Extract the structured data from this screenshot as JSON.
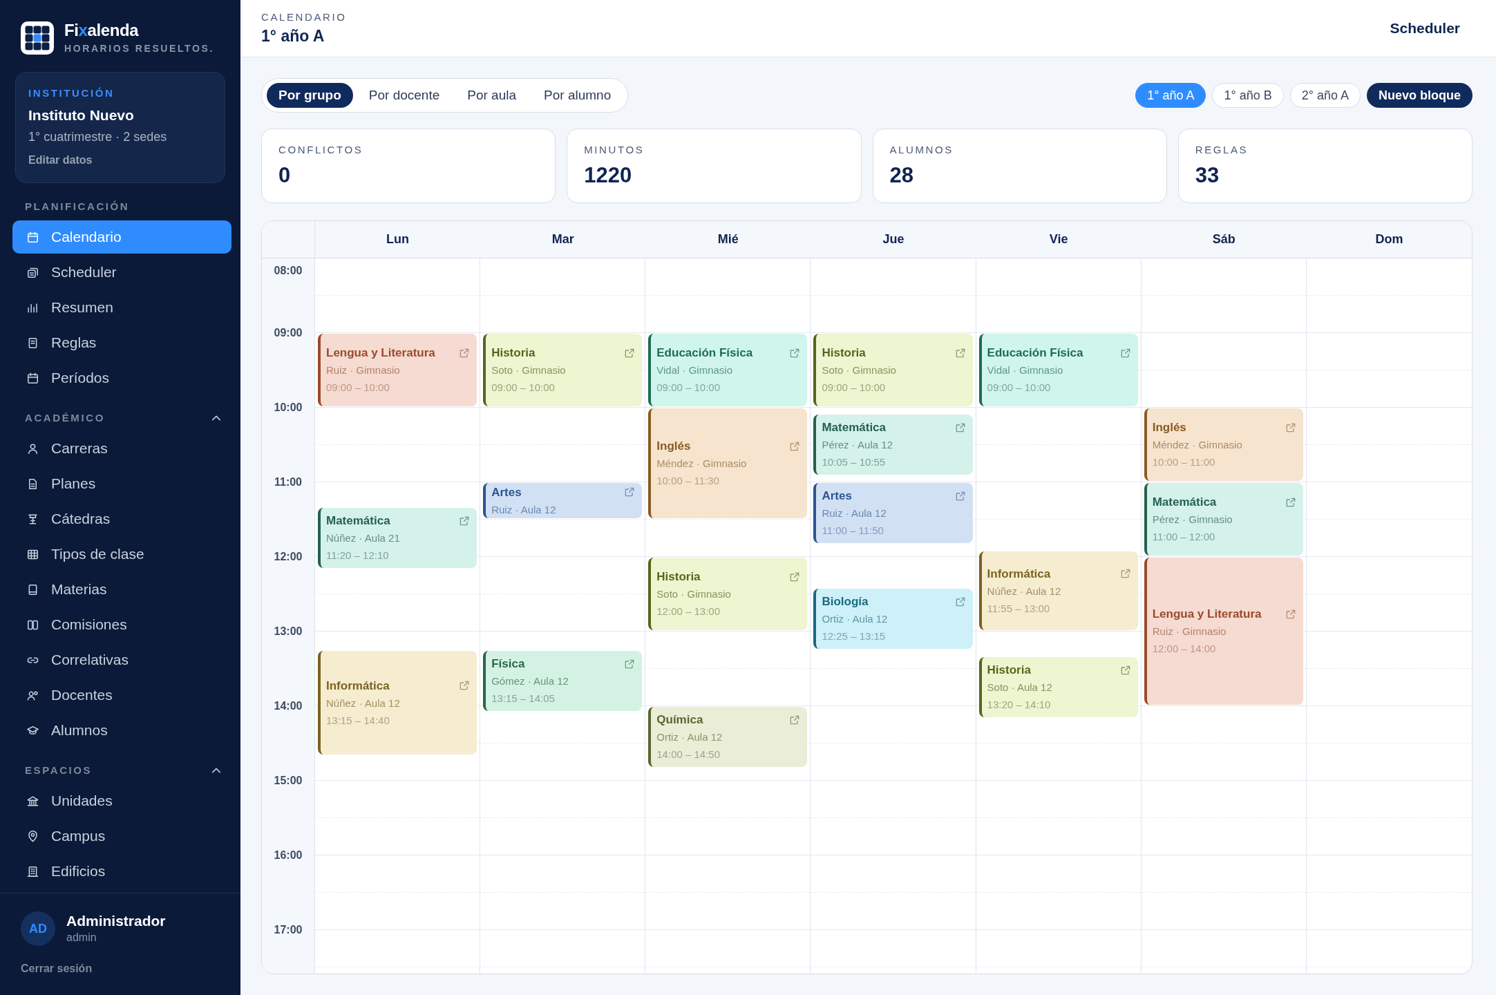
{
  "sidebar": {
    "brand": {
      "name_parts": [
        {
          "text": "Fi",
          "accent": false
        },
        {
          "text": "x",
          "accent": true
        },
        {
          "text": "alenda",
          "accent": false
        }
      ],
      "tagline": "HORARIOS RESUELTOS."
    },
    "institution": {
      "label": "INSTITUCIÓN",
      "name": "Instituto Nuevo",
      "meta": "1° cuatrimestre · 2 sedes",
      "link": "Editar datos"
    },
    "sections": [
      {
        "title": "PLANIFICACIÓN",
        "items": [
          {
            "label": "Calendario",
            "selected": true
          },
          {
            "label": "Scheduler",
            "selected": false
          },
          {
            "label": "Resumen",
            "selected": false
          },
          {
            "label": "Reglas",
            "selected": false
          },
          {
            "label": "Períodos",
            "selected": false
          }
        ]
      },
      {
        "title": "ACADÉMICO",
        "expanded": true,
        "items": [
          {
            "label": "Carreras",
            "selected": false
          },
          {
            "label": "Planes",
            "selected": false
          },
          {
            "label": "Cátedras",
            "selected": false
          },
          {
            "label": "Tipos de clase",
            "selected": false
          },
          {
            "label": "Materias",
            "selected": false
          },
          {
            "label": "Comisiones",
            "selected": false
          },
          {
            "label": "Correlativas",
            "selected": false
          },
          {
            "label": "Docentes",
            "selected": false
          },
          {
            "label": "Alumnos",
            "selected": false
          }
        ]
      },
      {
        "title": "ESPACIOS",
        "expanded": true,
        "items": [
          {
            "label": "Unidades",
            "selected": false
          },
          {
            "label": "Campus",
            "selected": false
          },
          {
            "label": "Edificios",
            "selected": false
          }
        ]
      }
    ],
    "user": {
      "initials": "AD",
      "name": "Administrador",
      "role": "admin",
      "logout": "Cerrar sesión"
    }
  },
  "header": {
    "eyebrow": "CALENDARIO",
    "title": "1° año A",
    "action": "Scheduler"
  },
  "view_tabs": [
    {
      "label": "Por grupo",
      "selected": true
    },
    {
      "label": "Por docente",
      "selected": false
    },
    {
      "label": "Por aula",
      "selected": false
    },
    {
      "label": "Por alumno",
      "selected": false
    }
  ],
  "groups": [
    {
      "label": "1° año A",
      "selected": true
    },
    {
      "label": "1° año B",
      "selected": false
    },
    {
      "label": "2° año A",
      "selected": false
    }
  ],
  "new_button": "Nuevo bloque",
  "stats": [
    {
      "label": "CONFLICTOS",
      "value": "0"
    },
    {
      "label": "MINUTOS",
      "value": "1220"
    },
    {
      "label": "ALUMNOS",
      "value": "28"
    },
    {
      "label": "REGLAS",
      "value": "33"
    }
  ],
  "calendar": {
    "hours": [
      "08:00",
      "09:00",
      "10:00",
      "11:00",
      "12:00",
      "13:00",
      "14:00",
      "15:00",
      "16:00",
      "17:00"
    ],
    "days": [
      {
        "label": "Lun",
        "events": [
          {
            "title": "Lengua y Literatura",
            "detail": "Ruiz · Gimnasio",
            "time": "09:00 – 10:00",
            "color": "#9a4a2c"
          },
          {
            "title": "Matemática",
            "detail": "Núñez · Aula 21",
            "time": "11:20 – 12:10",
            "color": "#24614f"
          },
          {
            "title": "Informática",
            "detail": "Núñez · Aula 12",
            "time": "13:15 – 14:40",
            "color": "#7a6320"
          }
        ]
      },
      {
        "label": "Mar",
        "events": [
          {
            "title": "Historia",
            "detail": "Soto · Gimnasio",
            "time": "09:00 – 10:00",
            "color": "#56661c"
          },
          {
            "title": "Artes",
            "detail": "Ruiz · Aula 12",
            "color": "#2c5592"
          },
          {
            "title": "Física",
            "detail": "Gómez · Aula 12",
            "time": "13:15 – 14:05",
            "color": "#276847"
          }
        ]
      },
      {
        "label": "Mié",
        "events": [
          {
            "title": "Educación Física",
            "detail": "Vidal · Gimnasio",
            "time": "09:00 – 10:00",
            "color": "#1d6b57"
          },
          {
            "title": "Inglés",
            "detail": "Méndez · Gimnasio",
            "time": "10:00 – 11:30",
            "color": "#8a5a22"
          },
          {
            "title": "Historia",
            "detail": "Soto · Gimnasio",
            "time": "12:00 – 13:00",
            "color": "#56661c"
          },
          {
            "title": "Química",
            "detail": "Ortiz · Aula 12",
            "time": "14:00 – 14:50",
            "color": "#5a6530"
          }
        ]
      },
      {
        "label": "Jue",
        "events": [
          {
            "title": "Historia",
            "detail": "Soto · Gimnasio",
            "time": "09:00 – 10:00",
            "color": "#56661c"
          },
          {
            "title": "Matemática",
            "detail": "Pérez · Aula 12",
            "time": "10:05 – 10:55",
            "color": "#24614f"
          },
          {
            "title": "Artes",
            "detail": "Ruiz · Aula 12",
            "time": "11:00 – 11:50",
            "color": "#2c5592"
          },
          {
            "title": "Biología",
            "detail": "Ortiz · Aula 12",
            "time": "12:25 – 13:15",
            "color": "#1a6b7f"
          }
        ]
      },
      {
        "label": "Vie",
        "events": [
          {
            "title": "Educación Física",
            "detail": "Vidal · Gimnasio",
            "time": "09:00 – 10:00",
            "color": "#1d6b57"
          },
          {
            "title": "Informática",
            "detail": "Núñez · Aula 12",
            "time": "11:55 – 13:00",
            "color": "#7a6320"
          },
          {
            "title": "Historia",
            "detail": "Soto · Aula 12",
            "time": "13:20 – 14:10",
            "color": "#56661c"
          }
        ]
      },
      {
        "label": "Sáb",
        "events": [
          {
            "title": "Inglés",
            "detail": "Méndez · Gimnasio",
            "time": "10:00 – 11:00",
            "color": "#8a5a22"
          },
          {
            "title": "Matemática",
            "detail": "Pérez · Gimnasio",
            "time": "11:00 – 12:00",
            "color": "#24614f"
          },
          {
            "title": "Lengua y Literatura",
            "detail": "Ruiz · Gimnasio",
            "time": "12:00 – 14:00",
            "color": "#9a4a2c"
          }
        ]
      },
      {
        "label": "Dom"
      }
    ]
  }
}
